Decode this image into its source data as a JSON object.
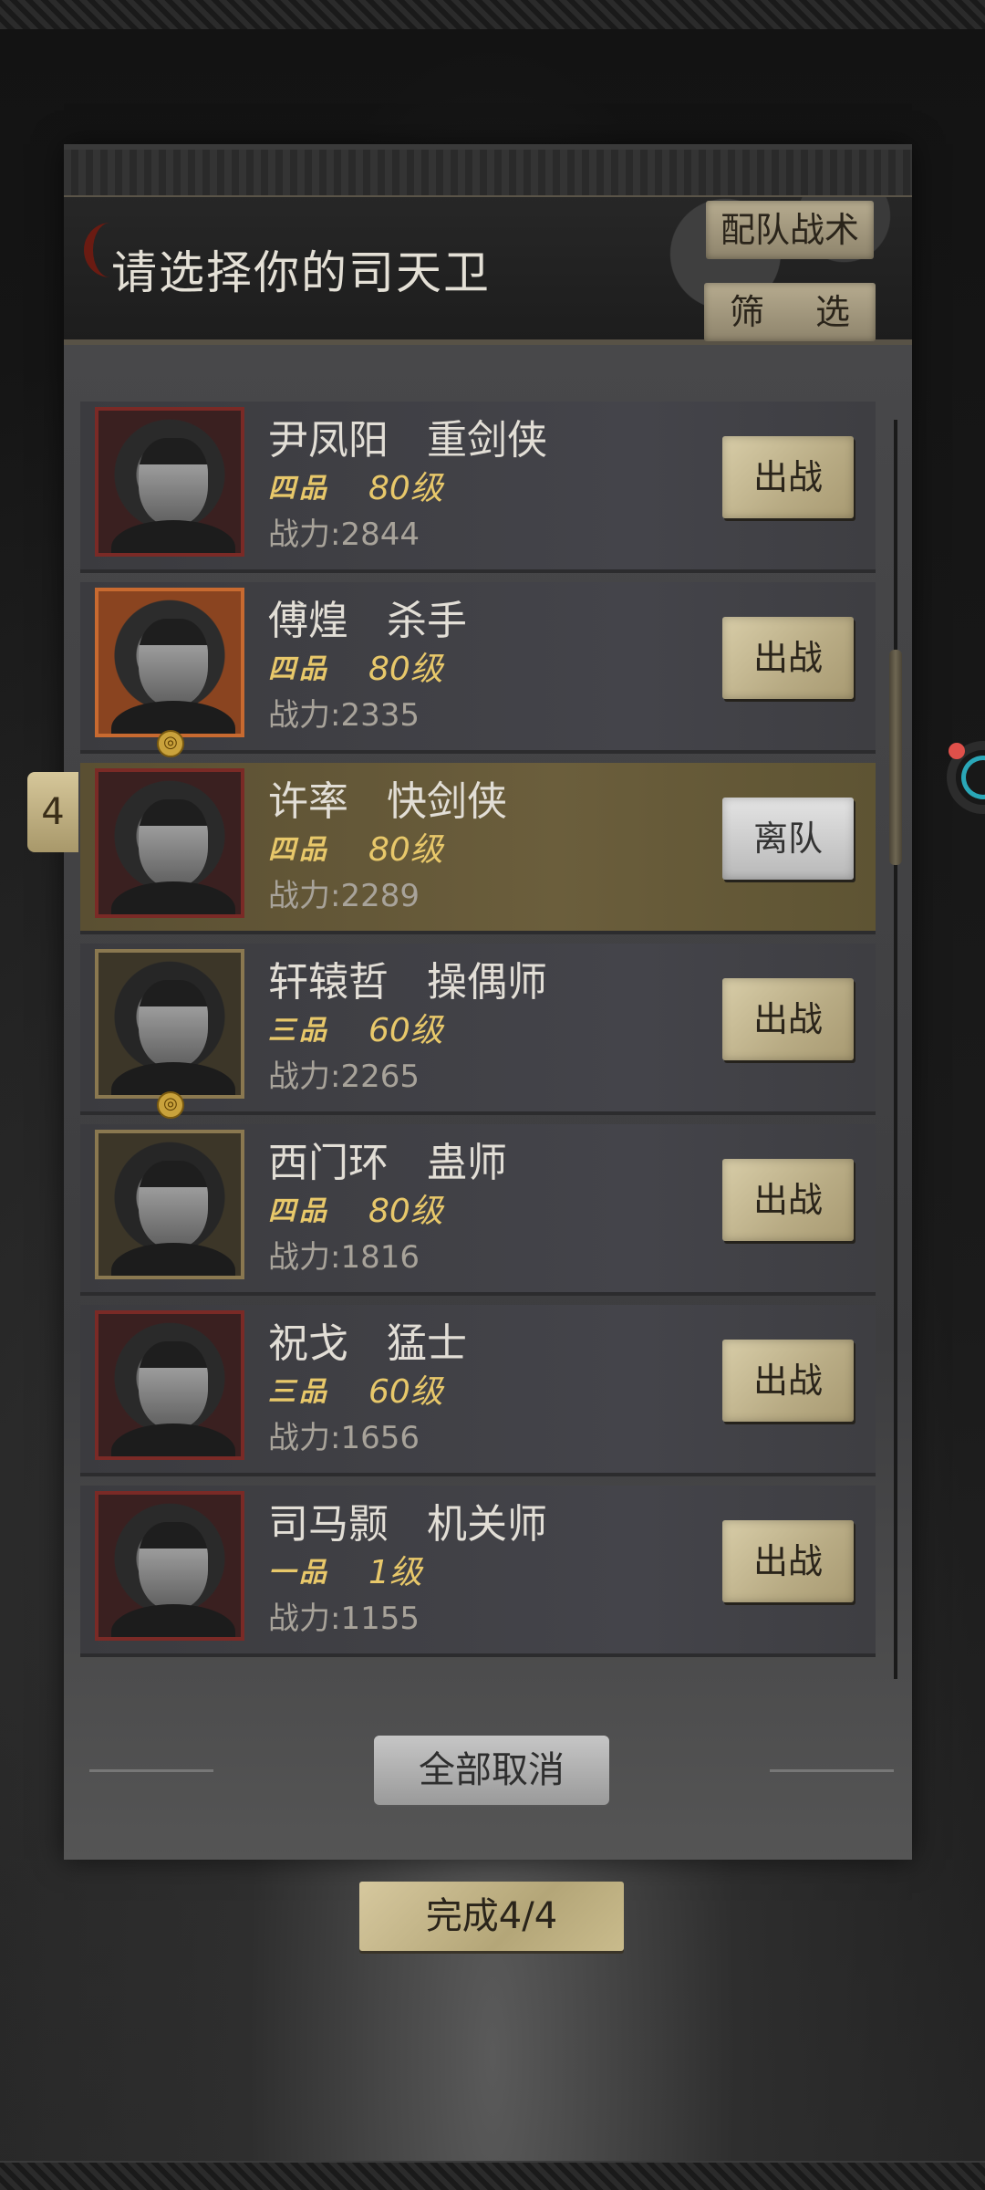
{
  "header": {
    "title": "请选择你的司天卫",
    "tactics_label": "配队战术",
    "filter_label": "筛 选"
  },
  "selected_order": "4",
  "roster": [
    {
      "name": "尹凤阳",
      "class": "重剑侠",
      "grade": "四品",
      "level": "80级",
      "power_label": "战力:",
      "power": "2844",
      "action": "出战",
      "state": "available"
    },
    {
      "name": "傅煌",
      "class": "杀手",
      "grade": "四品",
      "level": "80级",
      "power_label": "战力:",
      "power": "2335",
      "action": "出战",
      "state": "available"
    },
    {
      "name": "许率",
      "class": "快剑侠",
      "grade": "四品",
      "level": "80级",
      "power_label": "战力:",
      "power": "2289",
      "action": "离队",
      "state": "selected"
    },
    {
      "name": "轩辕哲",
      "class": "操偶师",
      "grade": "三品",
      "level": "60级",
      "power_label": "战力:",
      "power": "2265",
      "action": "出战",
      "state": "available"
    },
    {
      "name": "西门环",
      "class": "蛊师",
      "grade": "四品",
      "level": "80级",
      "power_label": "战力:",
      "power": "1816",
      "action": "出战",
      "state": "available"
    },
    {
      "name": "祝戈",
      "class": "猛士",
      "grade": "三品",
      "level": "60级",
      "power_label": "战力:",
      "power": "1656",
      "action": "出战",
      "state": "available"
    },
    {
      "name": "司马颢",
      "class": "机关师",
      "grade": "一品",
      "level": "1级",
      "power_label": "战力:",
      "power": "1155",
      "action": "出战",
      "state": "available"
    }
  ],
  "footer": {
    "cancel_all_label": "全部取消",
    "complete_label": "完成4/4"
  },
  "colors": {
    "grade_text": "#e8c86a",
    "selected_row": "#6b5e3c",
    "deploy_button": "#c6b98f"
  },
  "icons": {
    "portrait_badge": "spiral-badge-icon"
  }
}
